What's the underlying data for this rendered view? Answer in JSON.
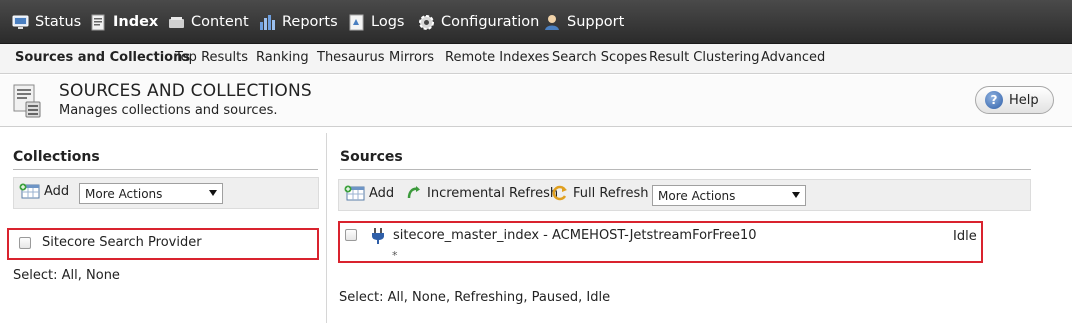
{
  "nav": {
    "items": [
      {
        "label": "Status",
        "icon": "monitor-icon"
      },
      {
        "label": "Index",
        "icon": "index-icon",
        "active": true
      },
      {
        "label": "Content",
        "icon": "content-icon"
      },
      {
        "label": "Reports",
        "icon": "reports-icon"
      },
      {
        "label": "Logs",
        "icon": "logs-icon"
      },
      {
        "label": "Configuration",
        "icon": "gear-icon"
      },
      {
        "label": "Support",
        "icon": "support-icon"
      }
    ]
  },
  "subnav": {
    "tabs": [
      {
        "label": "Sources and Collections",
        "active": true
      },
      {
        "label": "Top Results"
      },
      {
        "label": "Ranking"
      },
      {
        "label": "Thesaurus"
      },
      {
        "label": "Mirrors"
      },
      {
        "label": "Remote Indexes"
      },
      {
        "label": "Search Scopes"
      },
      {
        "label": "Result Clustering"
      },
      {
        "label": "Advanced"
      }
    ]
  },
  "header": {
    "title": "SOURCES AND COLLECTIONS",
    "description": "Manages collections and sources.",
    "help_label": "Help"
  },
  "collections": {
    "title": "Collections",
    "add_label": "Add",
    "more_actions": "More Actions",
    "items": [
      {
        "name": "Sitecore Search Provider"
      }
    ],
    "select_label": "Select:",
    "select_all": "All",
    "select_none": "None"
  },
  "sources": {
    "title": "Sources",
    "add_label": "Add",
    "incremental_label": "Incremental Refresh",
    "full_label": "Full Refresh",
    "more_actions": "More Actions",
    "items": [
      {
        "name": "sitecore_master_index - ACMEHOST-JetstreamForFree10",
        "status": "Idle",
        "sub": "*"
      }
    ],
    "select_label": "Select:",
    "select_options": [
      "All",
      "None",
      "Refreshing",
      "Paused",
      "Idle"
    ]
  },
  "colors": {
    "nav_bg": "#333333",
    "highlight_border": "#d9232e",
    "toolbar_bg": "#efefef"
  }
}
